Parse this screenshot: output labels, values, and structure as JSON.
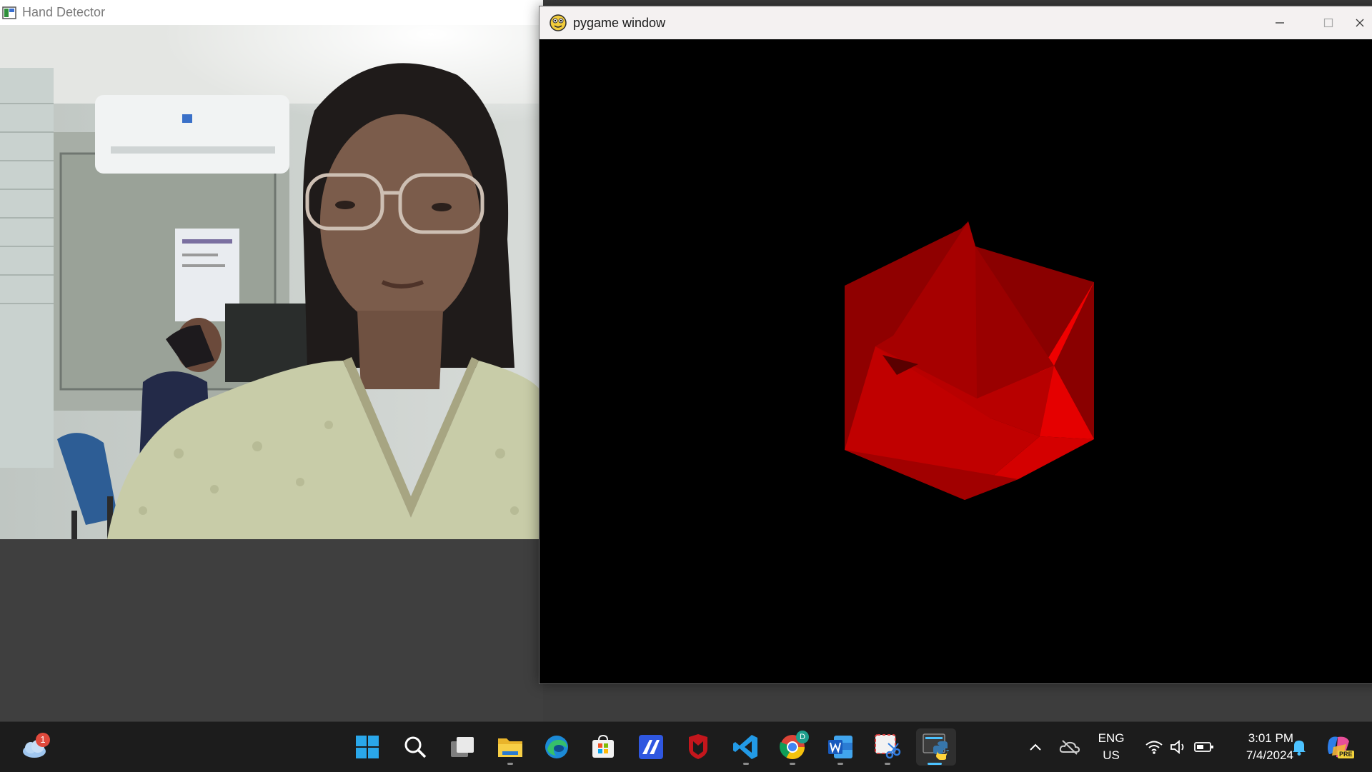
{
  "hand_detector": {
    "title": "Hand Detector",
    "feed": "webcam-feed"
  },
  "pygame": {
    "title": "pygame window",
    "object_color": "#cc0000"
  },
  "taskbar": {
    "weather_badge": "1",
    "chrome_badge": "D",
    "apps": [
      "start",
      "search",
      "task-view",
      "file-explorer",
      "edge",
      "microsoft-store",
      "app-a",
      "mcafee",
      "vscode",
      "chrome",
      "word",
      "snipping-tool",
      "python"
    ],
    "tray": {
      "lang_line1": "ENG",
      "lang_line2": "US",
      "time": "3:01 PM",
      "date": "7/4/2024",
      "copilot_badge": "PRE"
    }
  },
  "colors": {
    "taskbar": "#1c1c1c",
    "desktop": "#3d3d3d",
    "accent": "#4cc2ff"
  }
}
